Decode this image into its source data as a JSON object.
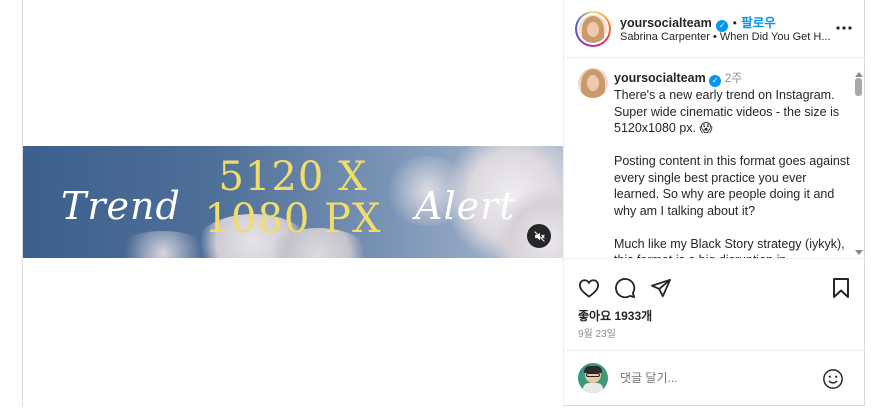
{
  "header": {
    "username": "yoursocialteam",
    "follow_label": "팔로우",
    "separator": "•",
    "audio_line": "Sabrina Carpenter • When Did You Get H..."
  },
  "banner": {
    "word_left": "Trend",
    "big_line1": "5120 X",
    "big_line2": "1080 PX",
    "word_right": "Alert"
  },
  "caption": {
    "username": "yoursocialteam",
    "time_ago": "2주",
    "paragraph1": "There's a new early trend on Instagram. Super wide cinematic videos - the size is 5120x1080 px. 😱",
    "paragraph2": "Posting content in this format goes against every single best practice you ever learned. So why are people doing it and why am I talking about it?",
    "paragraph3": "Much like my Black Story strategy (iykyk), this format is a big disruption in"
  },
  "stats": {
    "likes_text": "좋아요 1933개",
    "date_text": "9월 23일"
  },
  "compose": {
    "placeholder": "댓글 달기..."
  },
  "icons": [
    "heart-icon",
    "comment-icon",
    "share-icon",
    "bookmark-icon",
    "more-icon",
    "mute-icon",
    "emoji-icon",
    "verified-icon"
  ],
  "colors": {
    "accent": "#0095f6",
    "text": "#262626",
    "muted": "#8e8e8e",
    "banner_text": "#f2dc6a"
  }
}
